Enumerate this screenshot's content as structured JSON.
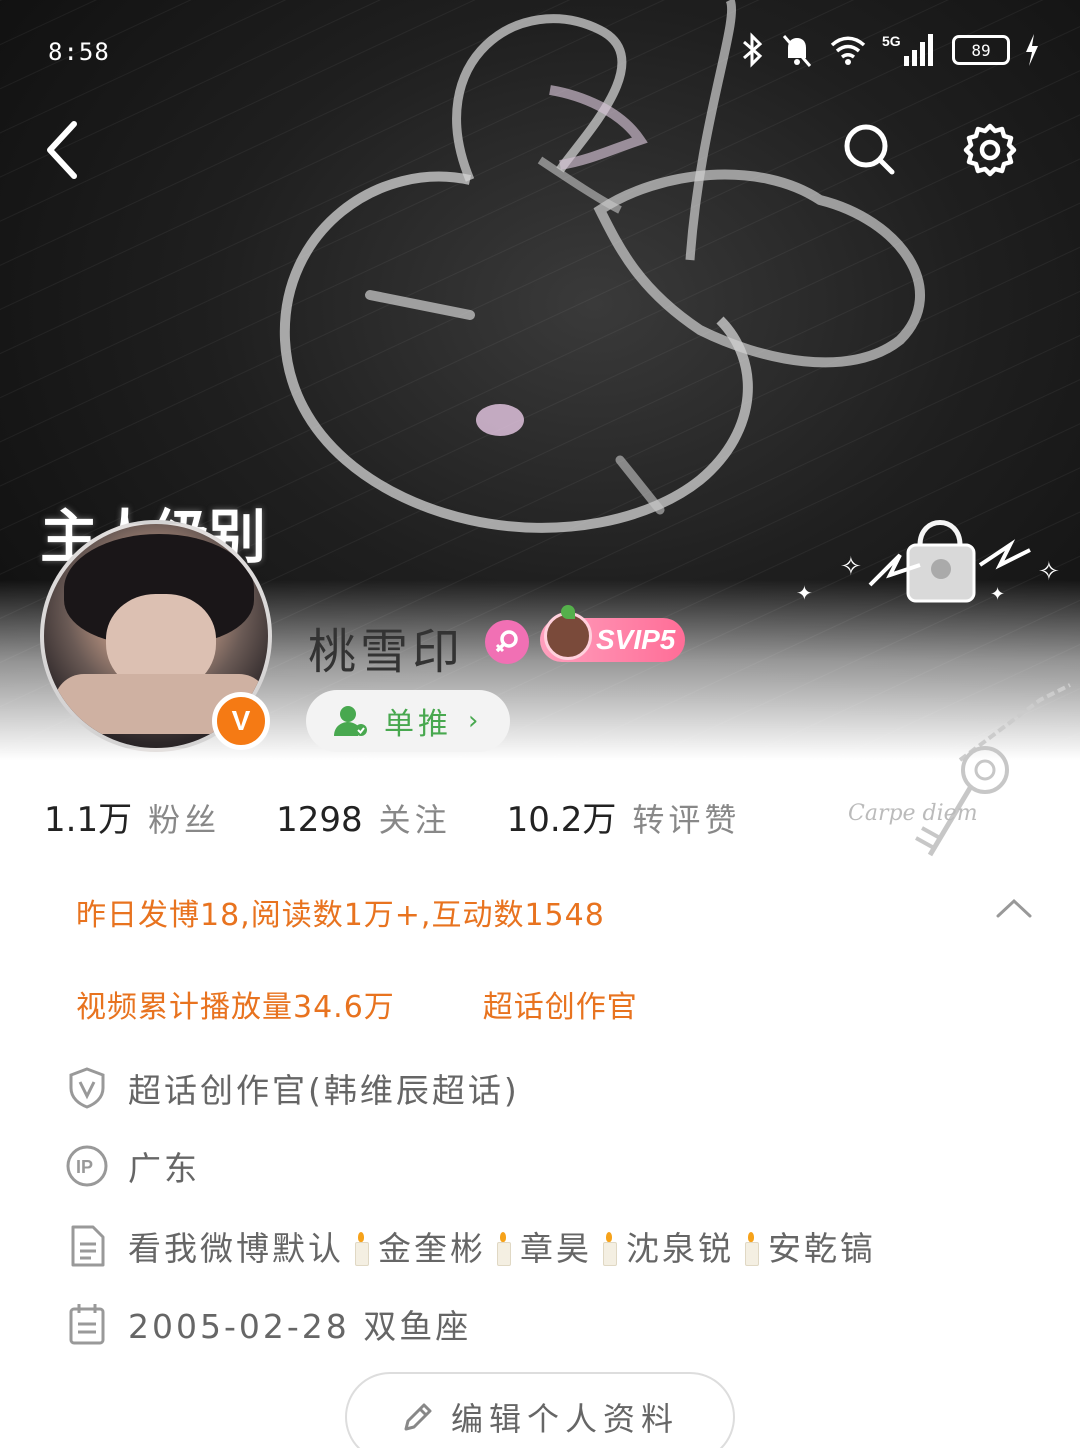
{
  "status_bar": {
    "time": "8:58",
    "network": "5G",
    "battery": "89"
  },
  "cover": {
    "rank_title": "主人级别"
  },
  "profile": {
    "nickname": "桃雪印",
    "vip_badge": "SVIP5",
    "relation_label": "单推",
    "verified_mark": "V"
  },
  "stats": [
    {
      "value": "1.1万",
      "label": "粉丝"
    },
    {
      "value": "1298",
      "label": "关注"
    },
    {
      "value": "10.2万",
      "label": "转评赞"
    }
  ],
  "highlights": {
    "summary": "昨日发博18,阅读数1万+,互动数1548",
    "video_plays": "视频累计播放量34.6万",
    "super_topic_role": "超话创作官"
  },
  "info": {
    "certification": "超话创作官(韩维辰超话)",
    "ip_location": "广东",
    "bio_parts": [
      "看我微博默认",
      "金奎彬",
      "章昊",
      "沈泉锐",
      "安乾镐"
    ],
    "birthday": "2005-02-28 双鱼座"
  },
  "edit_button": {
    "label": "编辑个人资料"
  },
  "icons": {
    "back": "back-icon",
    "search": "search-icon",
    "settings": "gear-icon",
    "gender": "female-icon",
    "certification": "shield-v-icon",
    "ip": "ip-icon",
    "bio": "document-icon",
    "birthday": "calendar-icon",
    "edit": "pencil-icon"
  },
  "colors": {
    "accent_orange": "#e8731f",
    "relation_green": "#48a84f",
    "verified_orange": "#f57a14",
    "svip_pink": "#ff6d97"
  }
}
